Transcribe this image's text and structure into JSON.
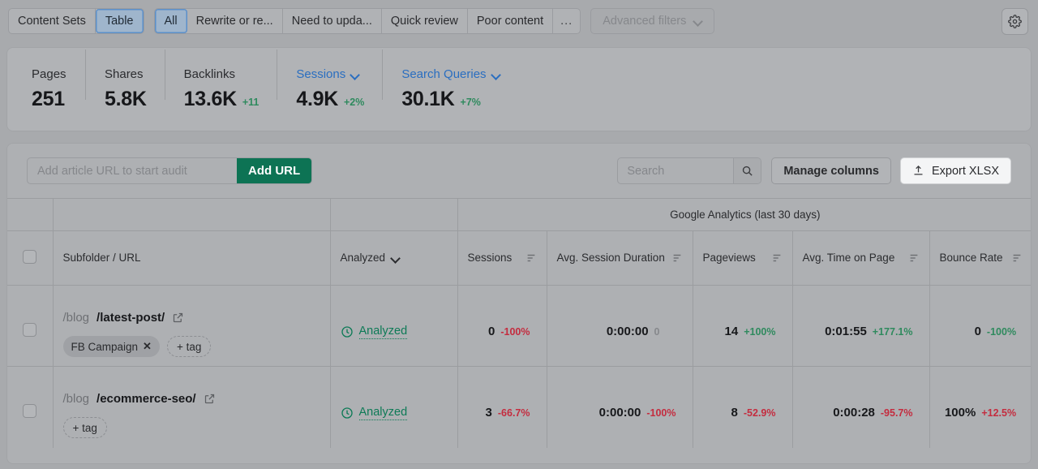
{
  "topbar": {
    "groups": [
      {
        "name": "content-sets",
        "chips": [
          {
            "label": "Content Sets",
            "selected": false
          },
          {
            "label": "Table",
            "selected": true
          }
        ]
      },
      {
        "name": "filters",
        "chips": [
          {
            "label": "All",
            "selected": true
          },
          {
            "label": "Rewrite or re...",
            "selected": false
          },
          {
            "label": "Need to upda...",
            "selected": false
          },
          {
            "label": "Quick review",
            "selected": false
          },
          {
            "label": "Poor content",
            "selected": false
          },
          {
            "label": "...",
            "selected": false
          }
        ]
      }
    ],
    "advanced_filters": "Advanced filters",
    "settings_icon": "gear-icon"
  },
  "metrics": [
    {
      "label": "Pages",
      "value": "251",
      "delta": "",
      "link": false
    },
    {
      "label": "Shares",
      "value": "5.8K",
      "delta": "",
      "link": false
    },
    {
      "label": "Backlinks",
      "value": "13.6K",
      "delta": "+11",
      "link": false
    },
    {
      "label": "Sessions",
      "value": "4.9K",
      "delta": "+2%",
      "link": true
    },
    {
      "label": "Search Queries",
      "value": "30.1K",
      "delta": "+7%",
      "link": true
    }
  ],
  "toolbar": {
    "url_placeholder": "Add article URL to start audit",
    "url_value": "",
    "add_url_label": "Add URL",
    "search_placeholder": "Search",
    "search_value": "",
    "search_icon": "search-icon",
    "manage_columns_label": "Manage columns",
    "export_label": "Export XLSX",
    "export_icon": "upload-icon"
  },
  "table": {
    "group_header": "Google Analytics (last 30 days)",
    "columns": {
      "subfolder": "Subfolder / URL",
      "analyzed": "Analyzed",
      "sessions": "Sessions",
      "avg_session_duration": "Avg. Session Duration",
      "pageviews": "Pageviews",
      "avg_time_on_page": "Avg. Time on Page",
      "bounce_rate": "Bounce Rate"
    },
    "add_tag_label": "+ tag",
    "analyzed_label": "Analyzed",
    "rows": [
      {
        "url_prefix": "/blog",
        "url_main": "/latest-post/",
        "tags": [
          "FB Campaign"
        ],
        "status": "Analyzed",
        "sessions": {
          "value": "0",
          "delta": "-100%",
          "dir": "down"
        },
        "avg_session_duration": {
          "value": "0:00:00",
          "delta": "0",
          "dir": "muted"
        },
        "pageviews": {
          "value": "14",
          "delta": "+100%",
          "dir": "up"
        },
        "avg_time_on_page": {
          "value": "0:01:55",
          "delta": "+177.1%",
          "dir": "up"
        },
        "bounce_rate": {
          "value": "0",
          "delta": "-100%",
          "dir": "up"
        }
      },
      {
        "url_prefix": "/blog",
        "url_main": "/ecommerce-seo/",
        "tags": [],
        "status": "Analyzed",
        "sessions": {
          "value": "3",
          "delta": "-66.7%",
          "dir": "down"
        },
        "avg_session_duration": {
          "value": "0:00:00",
          "delta": "-100%",
          "dir": "down"
        },
        "pageviews": {
          "value": "8",
          "delta": "-52.9%",
          "dir": "down"
        },
        "avg_time_on_page": {
          "value": "0:00:28",
          "delta": "-95.7%",
          "dir": "down"
        },
        "bounce_rate": {
          "value": "100%",
          "delta": "+12.5%",
          "dir": "down"
        }
      }
    ]
  },
  "colors": {
    "accent_green": "#0d7354",
    "positive": "#2f8a5e",
    "negative": "#c42c3f",
    "link_blue": "#2a6ec0",
    "selected_chip": "#9fb5cc"
  }
}
